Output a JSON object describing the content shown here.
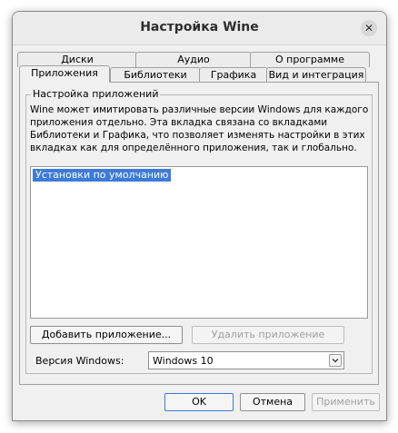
{
  "window": {
    "title": "Настройка Wine",
    "close_glyph": "✕"
  },
  "tabs": {
    "top_row": [
      "Диски",
      "Аудио",
      "О программе"
    ],
    "bottom_row": [
      "Приложения",
      "Библиотеки",
      "Графика",
      "Вид и интеграция"
    ],
    "active": "Приложения"
  },
  "apps": {
    "group_title": "Настройка приложений",
    "description": [
      "Wine может имитировать различные версии Windows для каждого",
      "приложения отдельно. Эта вкладка связана со вкладками",
      "Библиотеки и Графика, что позволяет изменять настройки в этих",
      "вкладках как для определённого приложения, так и глобально."
    ],
    "list_items": [
      "Установки по умолчанию"
    ],
    "add_button": "Добавить приложение...",
    "remove_button": "Удалить приложение",
    "version_label": "Версия Windows:",
    "version_value": "Windows 10"
  },
  "footer": {
    "ok": "OK",
    "cancel": "Отмена",
    "apply": "Применить"
  }
}
